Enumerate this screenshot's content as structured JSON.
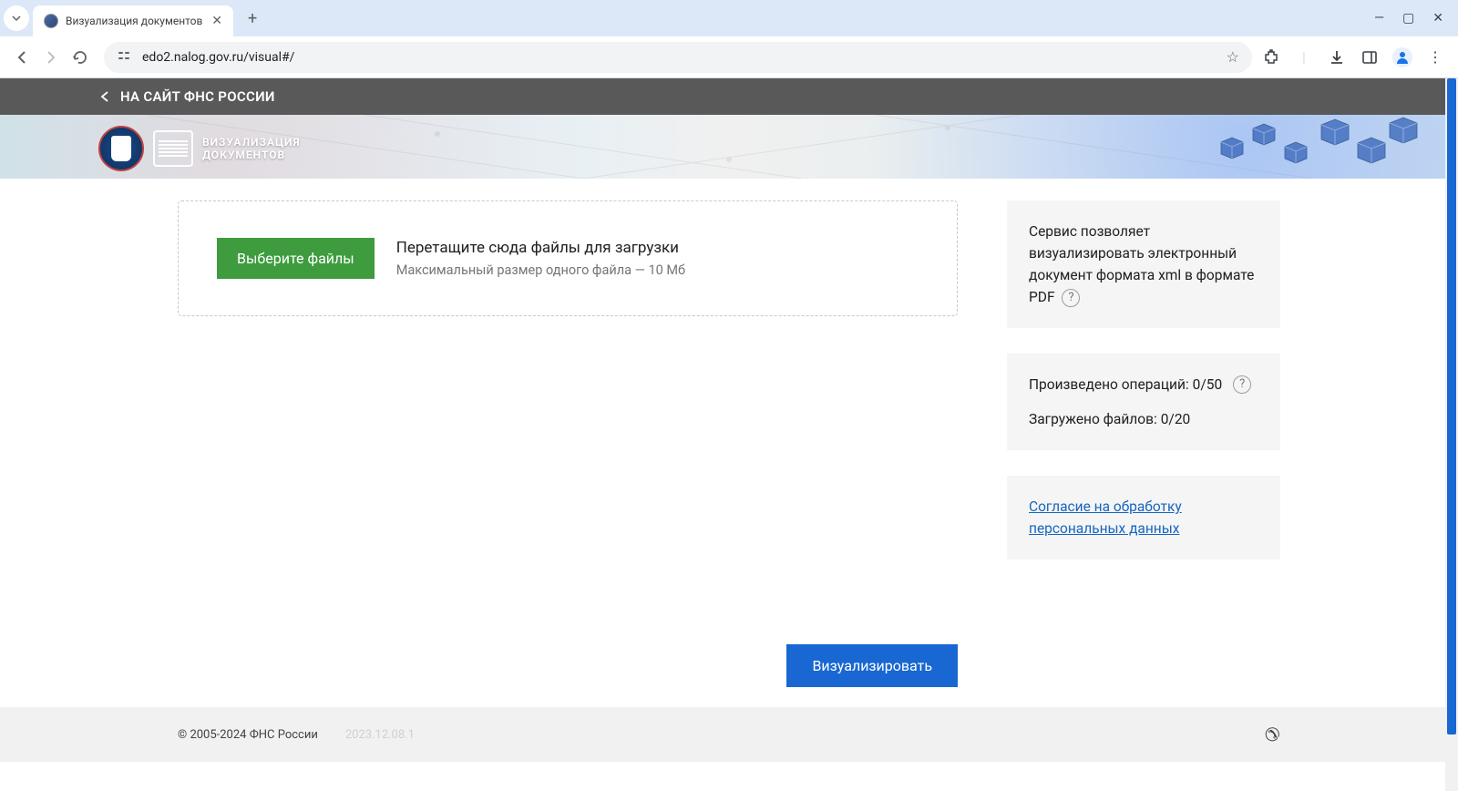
{
  "browser": {
    "tab_title": "Визуализация документов",
    "url": "edo2.nalog.gov.ru/visual#/"
  },
  "top_nav": {
    "back_label": "НА САЙТ ФНС РОССИИ"
  },
  "banner": {
    "title_line1": "ВИЗУАЛИЗАЦИЯ",
    "title_line2": "ДОКУМЕНТОВ"
  },
  "upload": {
    "button_label": "Выберите файлы",
    "drop_title": "Перетащите сюда файлы для загрузки",
    "drop_sub": "Максимальный размер одного файла — 10 Мб"
  },
  "sidebar": {
    "info_text": "Сервис позволяет визуализировать электронный документ формата xml в формате PDF",
    "ops_label": "Произведено операций:",
    "ops_value": "0/50",
    "files_label": "Загружено файлов:",
    "files_value": "0/20",
    "consent_link": "Согласие на обработку персональных данных"
  },
  "action": {
    "visualize_label": "Визуализировать"
  },
  "footer": {
    "copyright": "© 2005-2024 ФНС России",
    "version": "2023.12.08.1"
  }
}
